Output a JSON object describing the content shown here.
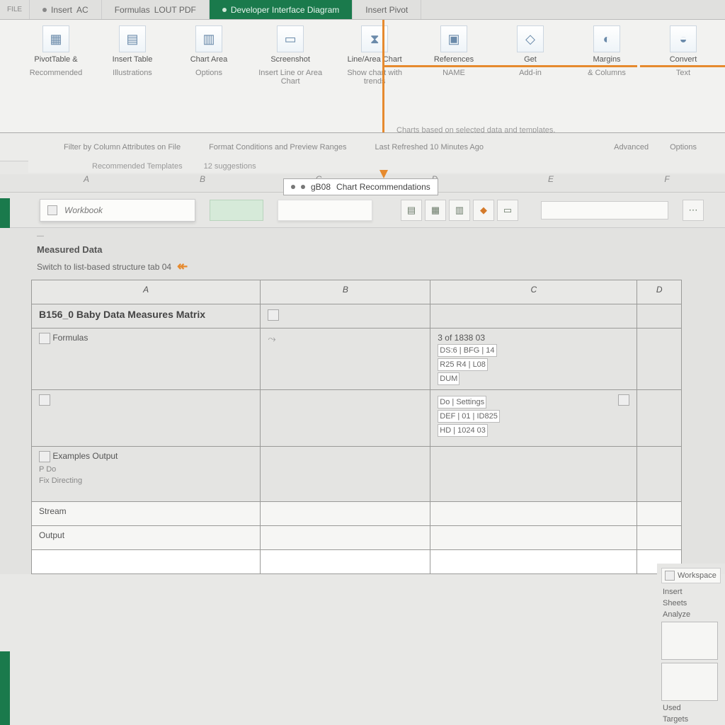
{
  "tabs": {
    "left_handle": "FILE",
    "t1_a": "Insert",
    "t1_b": "AC",
    "t2_a": "Formulas",
    "t2_b": "LOUT PDF",
    "t3": "Developer Interface Diagram",
    "t4": "Insert Pivot"
  },
  "ribbon": {
    "g1_label": "PivotTable &",
    "g1_sub": "Recommended",
    "g2_label": "Insert Table",
    "g2_sub": "Illustrations",
    "g3_label": "Chart Area",
    "g3_sub": "Options",
    "g4_label": "Screenshot",
    "g4_sub": "Insert Line or Area Chart",
    "g5_label": "Line/Area Chart",
    "g5_sub": "Show chart with trends",
    "g6_label": "References",
    "g6_sub": "NAME",
    "g7_label": "Get",
    "g7_sub": "Add-in",
    "g8_label": "Margins",
    "g8_sub": "& Columns",
    "g9_label": "Convert",
    "g9_sub": "Text",
    "sub_caption": "Charts based on selected data and templates.",
    "footer_a": "Recommended Templates",
    "footer_b": "12 suggestions"
  },
  "tooltip": {
    "code": "gB08",
    "text": "Chart Recommendations"
  },
  "thinbar": {
    "a": "Filter by Column Attributes on File",
    "b": "Format Conditions and Preview Ranges",
    "c": "Last Refreshed 10 Minutes Ago",
    "d": "Advanced",
    "e": "Options"
  },
  "columns": {
    "a": "A",
    "b": "B",
    "c": "C",
    "d": "D",
    "e": "E",
    "f": "F"
  },
  "namebox": {
    "value": "Workbook"
  },
  "sheethead": {
    "line1": "Measured Data",
    "line2": "Switch to list-based structure tab 04"
  },
  "table_headers": {
    "a": "A",
    "b": "B",
    "c": "C",
    "d": "D"
  },
  "cells": {
    "a1": "B156_0 Baby Data Measures Matrix",
    "a2": "Formulas",
    "c2": "3 of 1838 03",
    "c2_block1": "DS:6 | BFG | 14",
    "c2_block2": "R25   R4 | L08",
    "c2_block3": "DUM",
    "c3_block1": "Do | Settings",
    "c3_block2": "DEF | 01 | ID825",
    "c3_block3": "HD | 1024 03",
    "a4": "Examples  Output",
    "a4_s1": "P   Do",
    "a4_s2": "Fix Directing",
    "a5": "Stream",
    "a6": "Output"
  },
  "sidepanel": {
    "hdr": "Workspace",
    "i1": "Insert",
    "i2": "Sheets",
    "i3": "Analyze",
    "i4": "Used",
    "i5": "Targets"
  }
}
